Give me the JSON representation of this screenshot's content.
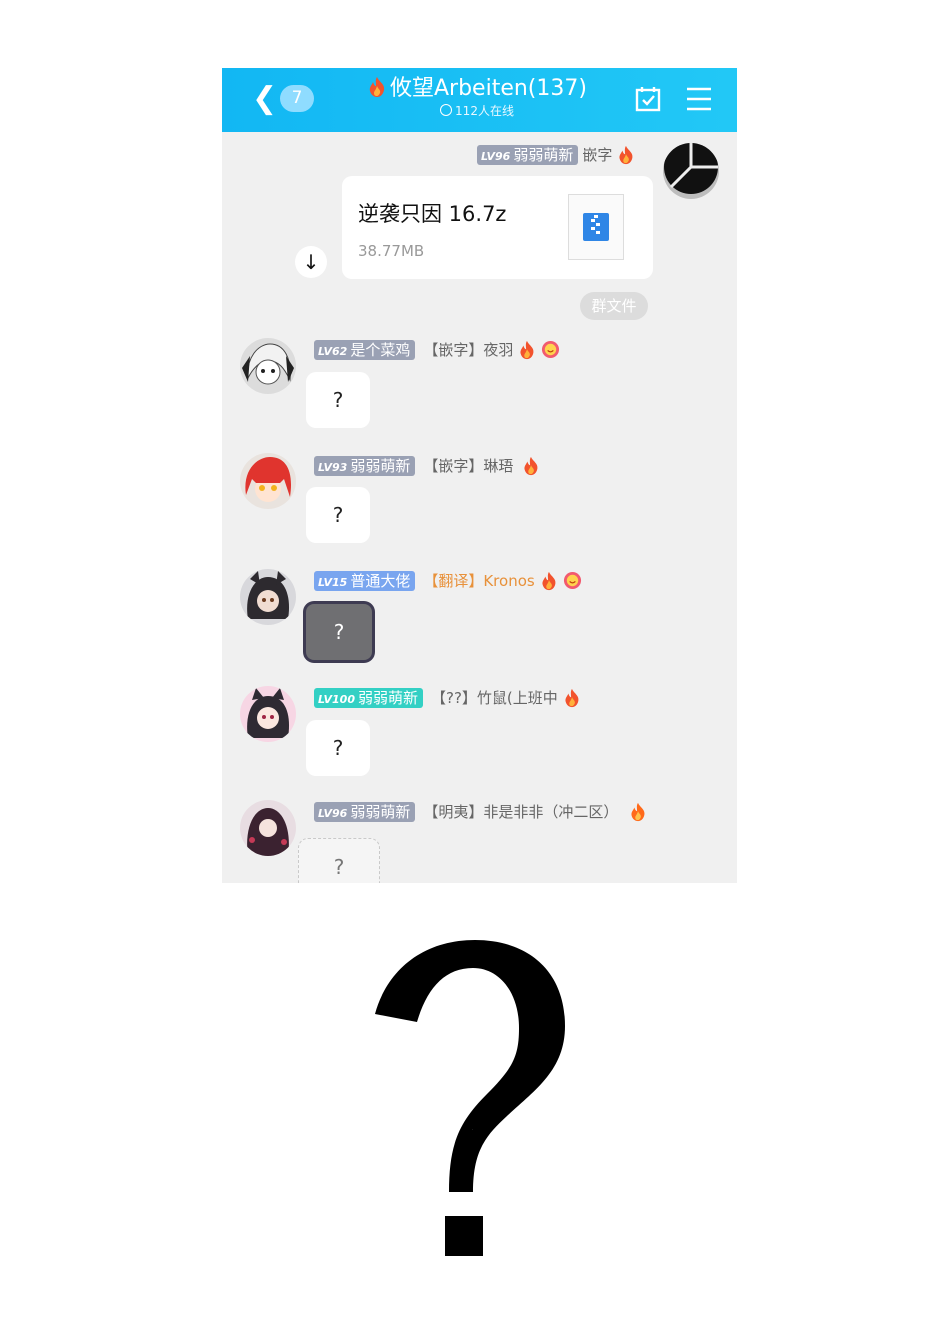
{
  "header": {
    "back_count": "7",
    "title": "攸望Arbeiten(137)",
    "online_text": "112人在线"
  },
  "messages": [
    {
      "lv": "LV96",
      "badge": "弱弱萌新",
      "tag": "嵌字"
    },
    {
      "file_name": "逆袭只因 16.7z",
      "file_size": "38.77MB",
      "file_label": "群文件"
    },
    {
      "lv": "LV62",
      "badge": "是个菜鸡",
      "tag": "【嵌字】夜羽",
      "text": "?"
    },
    {
      "lv": "LV93",
      "badge": "弱弱萌新",
      "tag": "【嵌字】琳珸",
      "text": "?"
    },
    {
      "lv": "LV15",
      "badge": "普通大佬",
      "tag": "【翻译】Kronos",
      "text": "?"
    },
    {
      "lv": "LV100",
      "badge": "弱弱萌新",
      "tag": "【??】竹鼠(上班中",
      "text": "?"
    },
    {
      "lv": "LV96",
      "badge": "弱弱萌新",
      "tag": "【明夷】非是非非（冲二区）",
      "text": "?"
    }
  ],
  "meme": {
    "text": "?"
  },
  "colors": {
    "header": "#12b7f3",
    "background": "#f0f0f0",
    "badge_gray": "#9aa1b4",
    "badge_teal": "#33d0c4",
    "badge_blue": "#79a5ef",
    "translator_tag": "#e8913a"
  }
}
